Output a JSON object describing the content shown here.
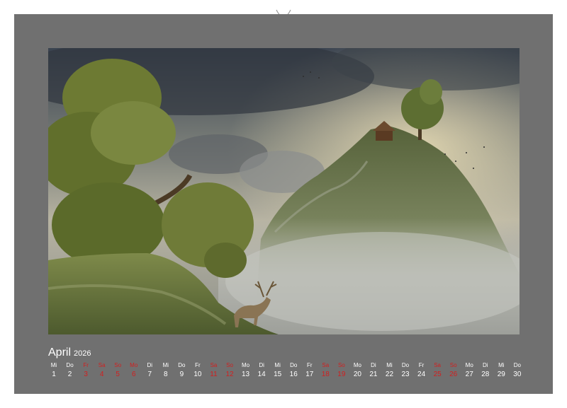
{
  "calendar": {
    "month": "April",
    "year": "2026",
    "weekday_labels": [
      "Mi",
      "Do",
      "Fr",
      "Sa",
      "So",
      "Mo",
      "Di",
      "Mi",
      "Do",
      "Fr",
      "Sa",
      "So",
      "Mo",
      "Di",
      "Mi",
      "Do",
      "Fr",
      "Sa",
      "So",
      "Mo",
      "Di",
      "Mi",
      "Do",
      "Fr",
      "Sa",
      "So",
      "Mo",
      "Di",
      "Mi",
      "Do"
    ],
    "dates": [
      "1",
      "2",
      "3",
      "4",
      "5",
      "6",
      "7",
      "8",
      "9",
      "10",
      "11",
      "12",
      "13",
      "14",
      "15",
      "16",
      "17",
      "18",
      "19",
      "20",
      "21",
      "22",
      "23",
      "24",
      "25",
      "26",
      "27",
      "28",
      "29",
      "30"
    ],
    "highlighted": [
      false,
      false,
      true,
      true,
      true,
      true,
      false,
      false,
      false,
      false,
      true,
      true,
      false,
      false,
      false,
      false,
      false,
      true,
      true,
      false,
      false,
      false,
      false,
      false,
      true,
      true,
      false,
      false,
      false,
      false
    ],
    "highlight_color": "#d21f1f",
    "text_color": "#ffffff"
  },
  "colors": {
    "background": "#ffffff",
    "sheet": "#707070",
    "binding_holes": "#8a8a8a"
  },
  "photo": {
    "subject": "fantasy landscape: stag on mossy rock, gnarled trees, mountain peak with cabin above clouds"
  }
}
